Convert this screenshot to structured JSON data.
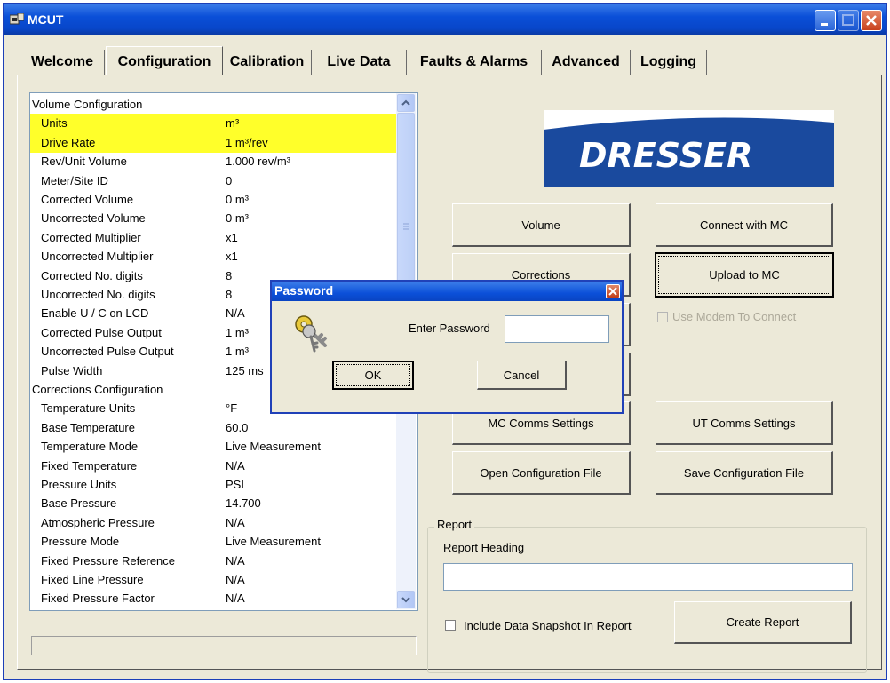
{
  "window": {
    "title": "MCUT"
  },
  "tabs": [
    {
      "label": "Welcome",
      "active": false
    },
    {
      "label": "Configuration",
      "active": true
    },
    {
      "label": "Calibration",
      "active": false
    },
    {
      "label": "Live Data",
      "active": false
    },
    {
      "label": "Faults & Alarms",
      "active": false
    },
    {
      "label": "Advanced",
      "active": false
    },
    {
      "label": "Logging",
      "active": false
    }
  ],
  "config_list": {
    "rows": [
      {
        "key": "Volume Configuration",
        "value": "",
        "header": true
      },
      {
        "key": "Units",
        "value": "m³",
        "highlight": true
      },
      {
        "key": "Drive Rate",
        "value": "1 m³/rev",
        "highlight": true
      },
      {
        "key": "Rev/Unit Volume",
        "value": "1.000 rev/m³"
      },
      {
        "key": "Meter/Site ID",
        "value": "0"
      },
      {
        "key": "Corrected Volume",
        "value": "0 m³"
      },
      {
        "key": "Uncorrected Volume",
        "value": "0 m³"
      },
      {
        "key": "Corrected Multiplier",
        "value": "x1"
      },
      {
        "key": "Uncorrected Multiplier",
        "value": "x1"
      },
      {
        "key": "Corrected No. digits",
        "value": "8"
      },
      {
        "key": "Uncorrected No. digits",
        "value": "8"
      },
      {
        "key": "Enable U / C on LCD",
        "value": "N/A"
      },
      {
        "key": "Corrected Pulse Output",
        "value": "1 m³"
      },
      {
        "key": "Uncorrected Pulse Output",
        "value": "1 m³"
      },
      {
        "key": "Pulse Width",
        "value": "125 ms"
      },
      {
        "key": "Corrections Configuration",
        "value": "",
        "header": true
      },
      {
        "key": "Temperature Units",
        "value": "°F"
      },
      {
        "key": "Base Temperature",
        "value": "60.0"
      },
      {
        "key": "Temperature Mode",
        "value": "Live Measurement"
      },
      {
        "key": "Fixed Temperature",
        "value": "N/A"
      },
      {
        "key": "Pressure Units",
        "value": "PSI"
      },
      {
        "key": "Base Pressure",
        "value": "14.700"
      },
      {
        "key": "Atmospheric Pressure",
        "value": "N/A"
      },
      {
        "key": "Pressure Mode",
        "value": "Live Measurement"
      },
      {
        "key": "Fixed Pressure Reference",
        "value": "N/A"
      },
      {
        "key": "Fixed Line Pressure",
        "value": "N/A"
      },
      {
        "key": "Fixed Pressure Factor",
        "value": "N/A"
      }
    ],
    "highlight_color": "#ffff2a"
  },
  "logo": {
    "text": "DRESSER"
  },
  "buttons": {
    "volume": "Volume",
    "corrections": "Corrections",
    "mc_comms": "MC Comms Settings",
    "open_config": "Open Configuration File",
    "connect_mc": "Connect with MC",
    "upload_mc": "Upload to MC",
    "ut_comms": "UT Comms Settings",
    "save_config": "Save Configuration File"
  },
  "use_modem": {
    "label": "Use Modem To Connect",
    "checked": false,
    "enabled": false
  },
  "report": {
    "legend": "Report",
    "heading_label": "Report Heading",
    "heading_value": "",
    "snapshot_label": "Include Data Snapshot In Report",
    "snapshot_checked": false,
    "create_button": "Create Report"
  },
  "password_dialog": {
    "title": "Password",
    "prompt": "Enter Password",
    "value": "",
    "ok": "OK",
    "cancel": "Cancel",
    "icon": "keys-icon"
  }
}
